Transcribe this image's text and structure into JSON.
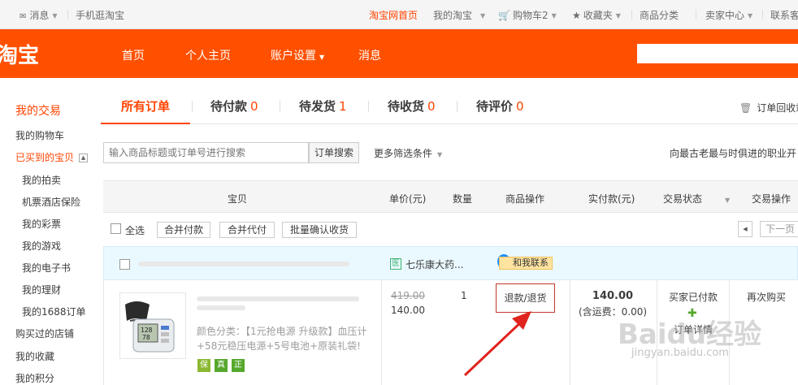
{
  "site_nav": {
    "message": "消息",
    "mobile": "手机逛淘宝",
    "home": "淘宝网首页",
    "my_taobao": "我的淘宝",
    "cart": "购物车2",
    "favorites": "收藏夹",
    "categories": "商品分类",
    "seller_center": "卖家中心",
    "contact": "联系客"
  },
  "header": {
    "logo": "淘宝",
    "nav": [
      "首页",
      "个人主页",
      "账户设置",
      "消息"
    ]
  },
  "sidebar": {
    "title": "我的交易",
    "items": [
      "我的购物车",
      "已买到的宝贝"
    ],
    "sub_items": [
      "我的拍卖",
      "机票酒店保险",
      "我的彩票",
      "我的游戏",
      "我的电子书",
      "我的理财",
      "我的1688订单"
    ],
    "more_items": [
      "购买过的店铺",
      "我的收藏",
      "我的积分"
    ]
  },
  "tabs": [
    {
      "label": "所有订单",
      "count": ""
    },
    {
      "label": "待付款",
      "count": "0"
    },
    {
      "label": "待发货",
      "count": "1"
    },
    {
      "label": "待收货",
      "count": "0"
    },
    {
      "label": "待评价",
      "count": "0"
    }
  ],
  "recycle_bin": "订单回收站",
  "search": {
    "placeholder": "输入商品标题或订单号进行搜索",
    "button": "订单搜索",
    "more_filters": "更多筛选条件",
    "promo": "向最古老最与时俱进的职业开"
  },
  "table_headers": [
    "宝贝",
    "单价(元)",
    "数量",
    "商品操作",
    "实付款(元)",
    "交易状态",
    "交易操作"
  ],
  "batch": {
    "select_all": "全选",
    "merge_pay": "合并付款",
    "merge_proxy": "合并代付",
    "batch_confirm": "批量确认收货",
    "next_page": "下一页"
  },
  "order": {
    "shop_icon": "医",
    "shop_name": "七乐康大药...",
    "chat_label": "和我联系",
    "attributes": "颜色分类：【1元抢电源 升级款】血压计+58元稳压电源+5号电池+原装礼袋!",
    "tags": [
      "保",
      "真",
      "正"
    ],
    "original_price": "419.00",
    "price": "140.00",
    "quantity": "1",
    "refund_button": "退款/退货",
    "paid": "140.00",
    "shipping": "(含运费：0.00)",
    "status": "买家已付款",
    "detail": "订单详情",
    "rebuy": "再次购买"
  },
  "watermark": {
    "text": "Baidu经验",
    "url": "jingyan.baidu.com"
  },
  "colors": {
    "brand": "#ff5000",
    "accent": "#f40",
    "annotation": "#e0231e"
  }
}
